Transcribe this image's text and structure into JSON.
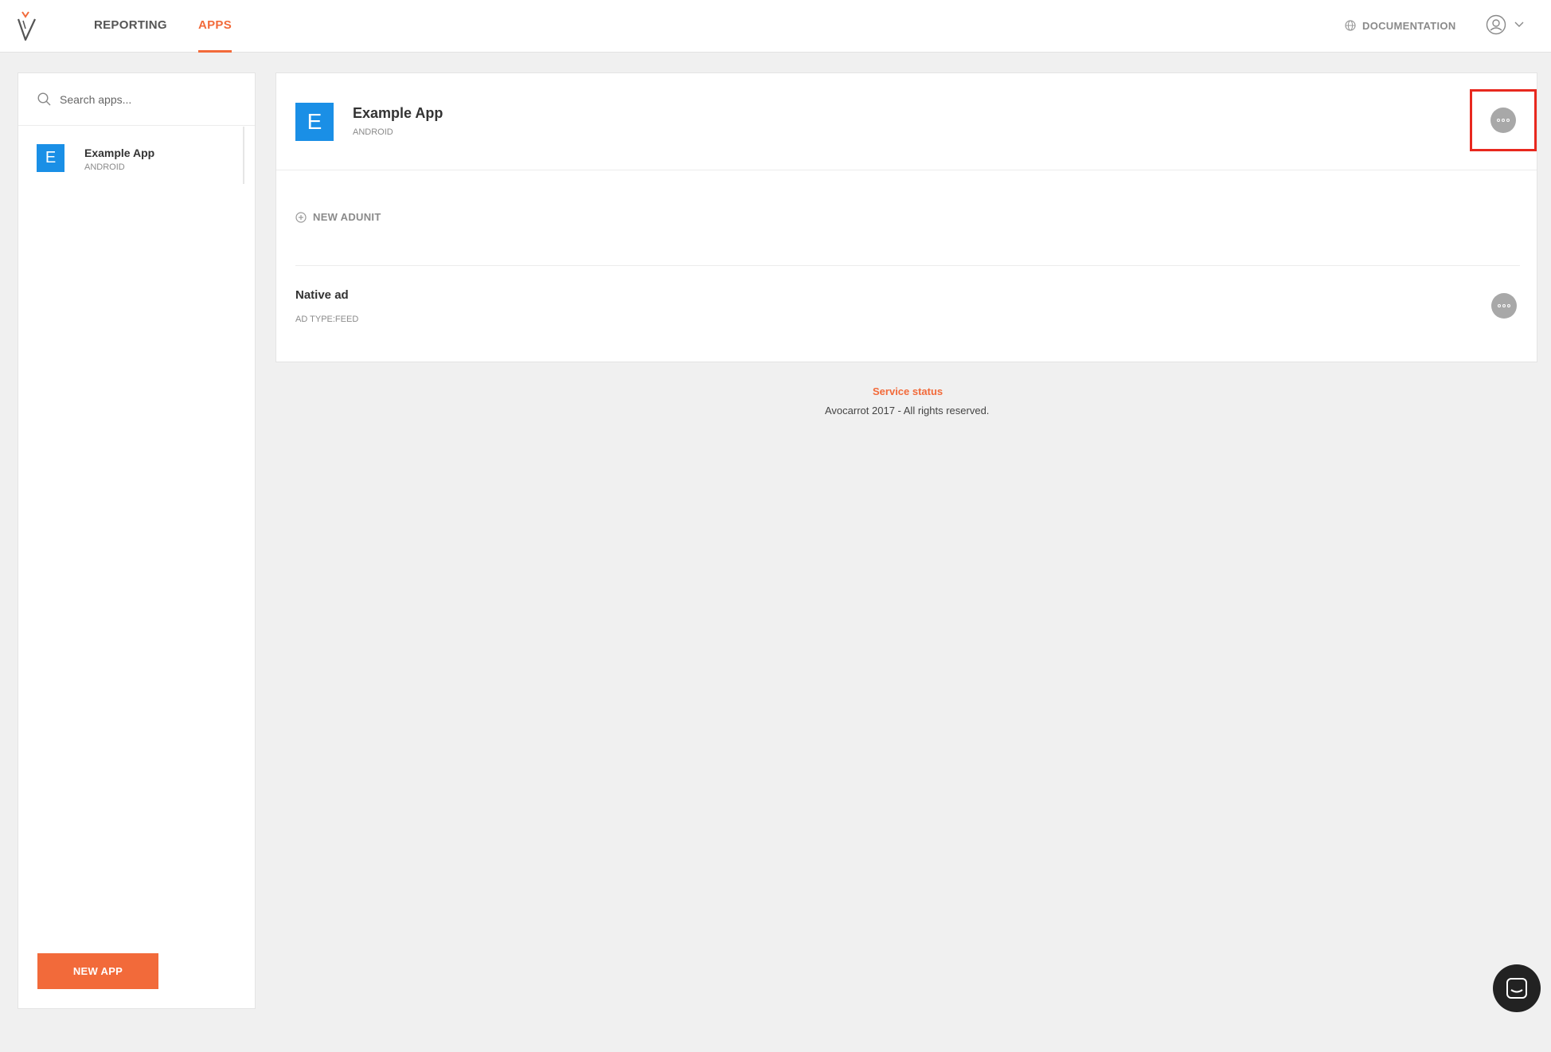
{
  "nav": {
    "tabs": [
      {
        "label": "REPORTING",
        "active": false
      },
      {
        "label": "APPS",
        "active": true
      }
    ],
    "documentation_label": "DOCUMENTATION",
    "icons": {
      "logo": "avocarrot-logo",
      "globe": "globe-icon",
      "user": "user-avatar-icon",
      "chevron": "chevron-down-icon"
    }
  },
  "sidebar": {
    "search": {
      "placeholder": "Search apps...",
      "value": ""
    },
    "apps": [
      {
        "initial": "E",
        "name": "Example App",
        "platform": "ANDROID"
      }
    ],
    "new_app_label": "NEW APP"
  },
  "main": {
    "app": {
      "initial": "E",
      "name": "Example App",
      "platform": "ANDROID"
    },
    "new_adunit_label": "NEW ADUNIT",
    "adunits": [
      {
        "name": "Native ad",
        "type": "AD TYPE:FEED"
      }
    ]
  },
  "footer": {
    "status_link": "Service status",
    "copyright": "Avocarrot 2017 - All rights reserved."
  },
  "colors": {
    "accent": "#f26a3a",
    "app_avatar": "#1a8fe6",
    "highlight": "#e8281e"
  }
}
